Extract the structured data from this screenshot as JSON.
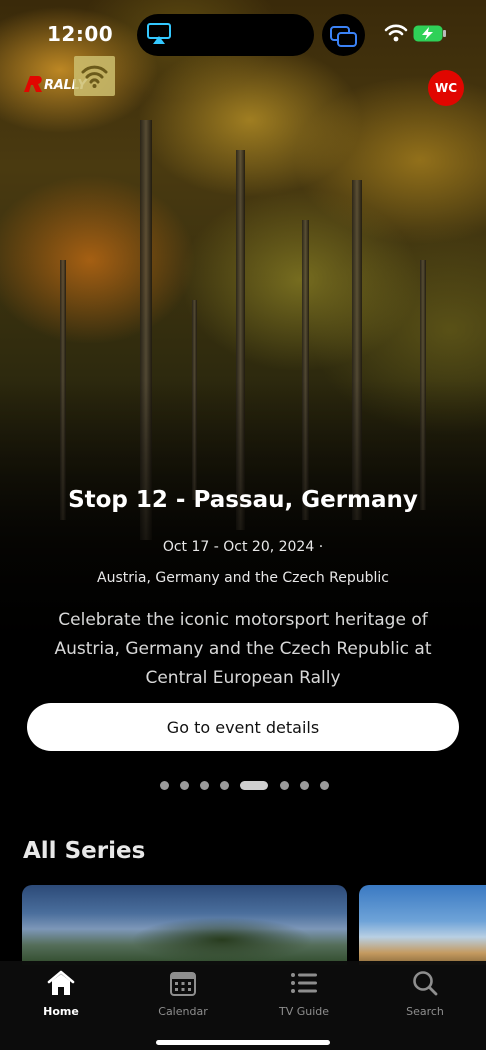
{
  "status_bar": {
    "time": "12:00",
    "icons": [
      "airplay-icon",
      "screen-mirroring-icon",
      "wifi-icon",
      "battery-charging-icon"
    ]
  },
  "header": {
    "logo_text": "RALLY",
    "cast_icon": "cast-icon",
    "avatar_initials": "WC",
    "avatar_color": "#e10600"
  },
  "hero": {
    "title": "Stop 12 - Passau, Germany",
    "dates": "Oct 17 - Oct 20, 2024 ·",
    "region": "Austria, Germany and the Czech Republic",
    "description": "Celebrate the iconic motorsport heritage of Austria, Germany and the Czech Republic at Central European Rally",
    "cta_label": "Go to event details",
    "carousel": {
      "count": 9,
      "active_index": 4
    }
  },
  "all_series": {
    "title": "All Series"
  },
  "tabbar": {
    "tabs": [
      {
        "label": "Home",
        "icon": "home-icon",
        "active": true
      },
      {
        "label": "Calendar",
        "icon": "calendar-icon",
        "active": false
      },
      {
        "label": "TV Guide",
        "icon": "tv-guide-icon",
        "active": false
      },
      {
        "label": "Search",
        "icon": "search-icon",
        "active": false
      }
    ]
  }
}
